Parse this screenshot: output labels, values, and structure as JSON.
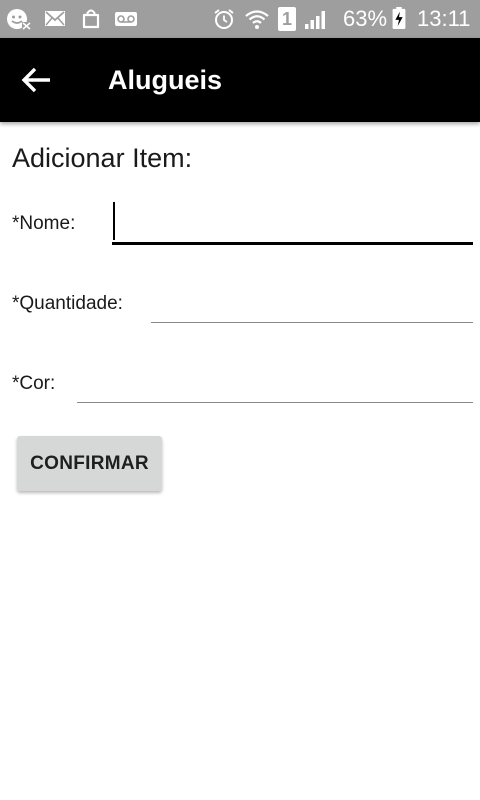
{
  "status_bar": {
    "battery_percent": "63%",
    "time": "13:11",
    "sim_slot": "1",
    "icons": [
      "emoji-notification-icon",
      "mail-icon",
      "shopping-bag-icon",
      "voicemail-icon",
      "alarm-icon",
      "wifi-icon",
      "sim-icon",
      "signal-icon",
      "battery-charging-icon"
    ]
  },
  "app_bar": {
    "title": "Alugueis",
    "background": "#000000"
  },
  "form": {
    "title": "Adicionar Item:",
    "fields": [
      {
        "label": "*Nome:",
        "value": "",
        "focused": true
      },
      {
        "label": "*Quantidade:",
        "value": ""
      },
      {
        "label": "*Cor:",
        "value": ""
      }
    ],
    "confirm_label": "CONFIRMAR"
  }
}
